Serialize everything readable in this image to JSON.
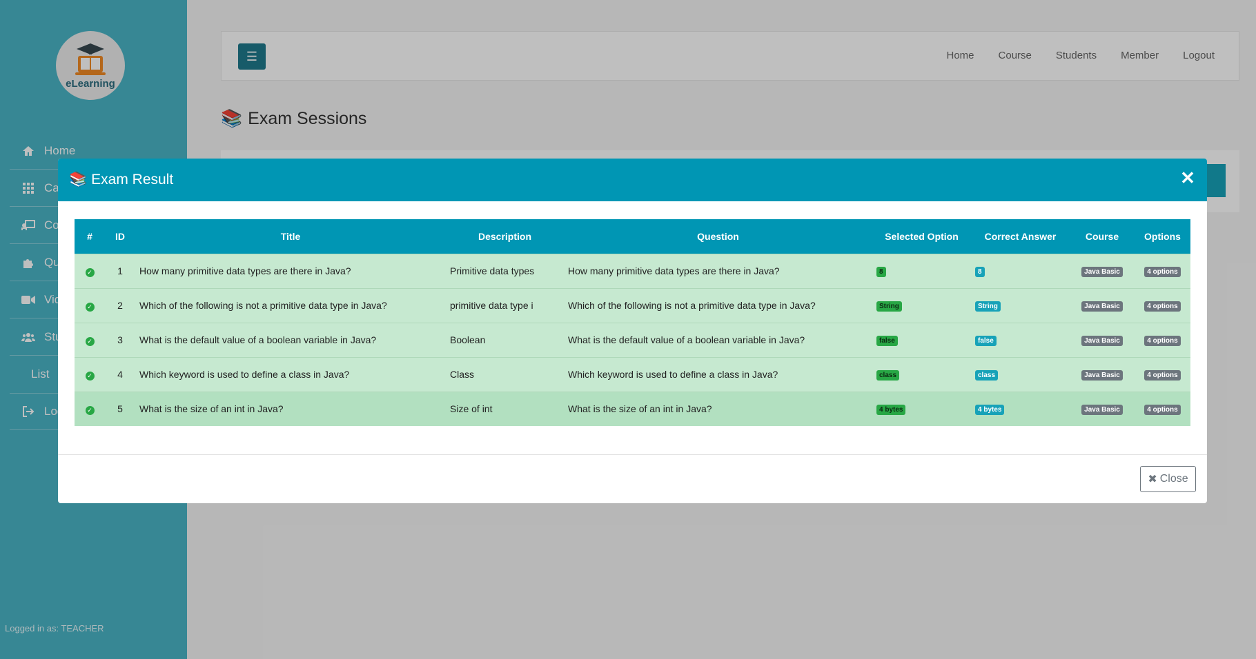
{
  "sidebar": {
    "logo_text": "eLearning",
    "items": [
      {
        "label": "Home",
        "icon": "home-icon"
      },
      {
        "label": "Categories",
        "icon": "grid-icon"
      },
      {
        "label": "Courses",
        "icon": "course-icon"
      },
      {
        "label": "Quizzes",
        "icon": "puzzle-icon"
      },
      {
        "label": "Videos",
        "icon": "video-icon"
      },
      {
        "label": "Students",
        "icon": "users-icon"
      },
      {
        "label": "List",
        "icon": ""
      },
      {
        "label": "Logout",
        "icon": "sign-out-icon"
      }
    ],
    "logged_in": "Logged in as: TEACHER"
  },
  "topnav": [
    "Home",
    "Course",
    "Students",
    "Member",
    "Logout"
  ],
  "page_title": "Exam Sessions",
  "modal": {
    "title": "Exam Result",
    "close_label": "Close",
    "columns": [
      "#",
      "ID",
      "Title",
      "Description",
      "Question",
      "Selected Option",
      "Correct Answer",
      "Course",
      "Options"
    ],
    "rows": [
      {
        "id": "1",
        "title": "How many primitive data types are there in Java?",
        "description": "Primitive data types",
        "question": "How many primitive data types are there in Java?",
        "selected": "8",
        "correct": "8",
        "course": "Java Basic",
        "options": "4 options"
      },
      {
        "id": "2",
        "title": "Which of the following is not a primitive data type in Java?",
        "description": "primitive data type i",
        "question": "Which of the following is not a primitive data type in Java?",
        "selected": "String",
        "correct": "String",
        "course": "Java Basic",
        "options": "4 options"
      },
      {
        "id": "3",
        "title": "What is the default value of a boolean variable in Java?",
        "description": "Boolean",
        "question": "What is the default value of a boolean variable in Java?",
        "selected": "false",
        "correct": "false",
        "course": "Java Basic",
        "options": "4 options"
      },
      {
        "id": "4",
        "title": "Which keyword is used to define a class in Java?",
        "description": "Class",
        "question": "Which keyword is used to define a class in Java?",
        "selected": "class",
        "correct": "class",
        "course": "Java Basic",
        "options": "4 options"
      },
      {
        "id": "5",
        "title": "What is the size of an int in Java?",
        "description": "Size of int",
        "question": "What is the size of an int in Java?",
        "selected": "4 bytes",
        "correct": "4 bytes",
        "course": "Java Basic",
        "options": "4 options"
      }
    ]
  },
  "colors": {
    "sidebar": "#4ab4c6",
    "header": "#0096b4",
    "row_success": "#c6e9d0"
  }
}
